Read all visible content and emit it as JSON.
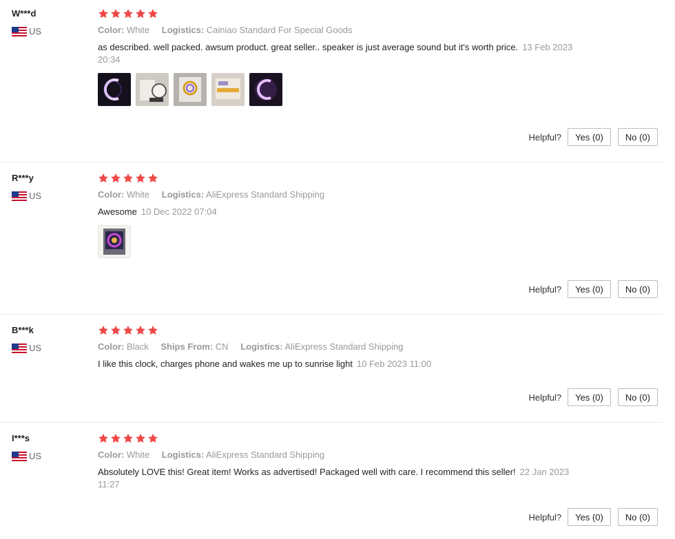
{
  "helpful_label": "Helpful?",
  "colors": {
    "star": "#f04848",
    "text": "#222222",
    "muted": "#999999"
  },
  "reviews": [
    {
      "user": "W***d",
      "country": "US",
      "rating": 5,
      "attrs": [
        {
          "label": "Color:",
          "value": "White"
        },
        {
          "label": "Logistics:",
          "value": "Cainiao Standard For Special Goods"
        }
      ],
      "text": "as described. well packed. awsum product. great seller.. speaker is just average sound but it's worth price.",
      "time": "13 Feb 2023 20:34",
      "photos": [
        "clock-lamp-photo-1",
        "clock-lamp-photo-2",
        "clock-lamp-photo-3",
        "package-photo-4",
        "clock-lamp-photo-5"
      ],
      "yes": "Yes (0)",
      "no": "No (0)"
    },
    {
      "user": "R***y",
      "country": "US",
      "rating": 5,
      "attrs": [
        {
          "label": "Color:",
          "value": "White"
        },
        {
          "label": "Logistics:",
          "value": "AliExpress Standard Shipping"
        }
      ],
      "text": "Awesome",
      "time": "10 Dec 2022 07:04",
      "photos": [
        "product-box-photo-1"
      ],
      "yes": "Yes (0)",
      "no": "No (0)"
    },
    {
      "user": "B***k",
      "country": "US",
      "rating": 5,
      "attrs": [
        {
          "label": "Color:",
          "value": "Black"
        },
        {
          "label": "Ships From:",
          "value": "CN"
        },
        {
          "label": "Logistics:",
          "value": "AliExpress Standard Shipping"
        }
      ],
      "text": "I like this clock, charges phone and wakes me up to sunrise light",
      "time": "10 Feb 2023 11:00",
      "photos": [],
      "yes": "Yes (0)",
      "no": "No (0)"
    },
    {
      "user": "I***s",
      "country": "US",
      "rating": 5,
      "attrs": [
        {
          "label": "Color:",
          "value": "White"
        },
        {
          "label": "Logistics:",
          "value": "AliExpress Standard Shipping"
        }
      ],
      "text": "Absolutely LOVE this! Great item! Works as advertised! Packaged well with care. I recommend this seller!",
      "time": "22 Jan 2023 11:27",
      "photos": [],
      "yes": "Yes (0)",
      "no": "No (0)"
    }
  ]
}
